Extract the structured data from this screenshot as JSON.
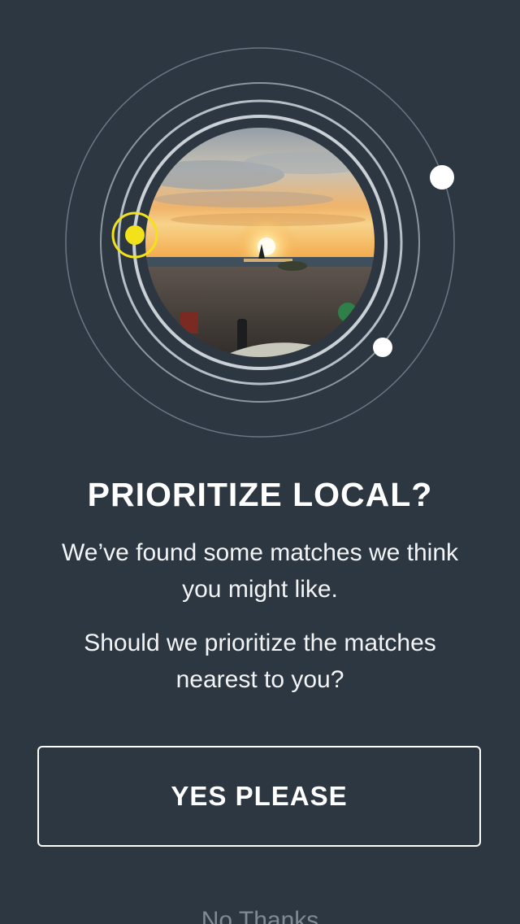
{
  "onboarding": {
    "title": "PRIORITIZE LOCAL?",
    "message_1": "We’ve found some matches we think you might like.",
    "message_2": "Should we prioritize the matches nearest to you?",
    "primary_button": "YES PLEASE",
    "secondary_link": "No Thanks"
  },
  "theme": {
    "background": "#2d3741",
    "accent_yellow": "#f3e21a",
    "text_white": "#ffffff"
  },
  "graphic": {
    "photo_subject": "sunset over beach with sailboat",
    "orbit_markers": [
      "yellow-location-dot",
      "white-dot",
      "white-dot"
    ]
  }
}
